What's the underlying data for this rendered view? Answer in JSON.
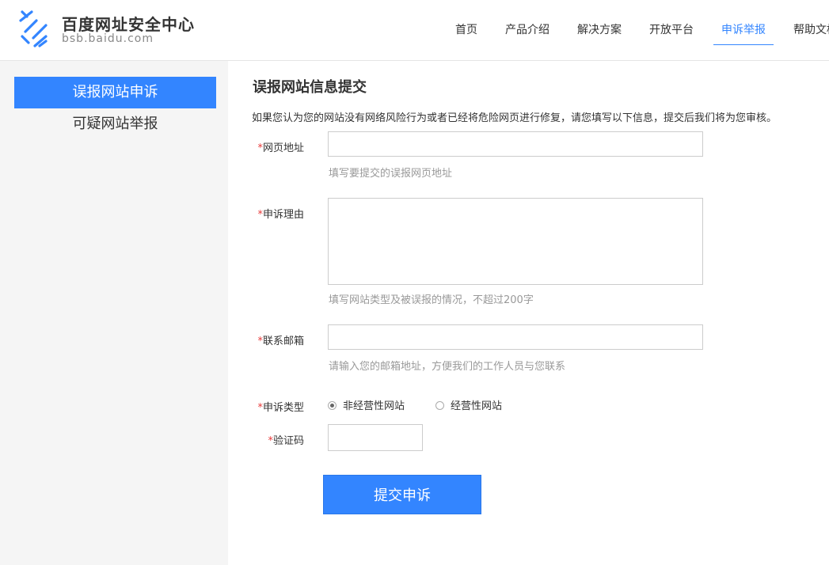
{
  "header": {
    "logo_title": "百度网址安全中心",
    "logo_subtitle": "bsb.baidu.com",
    "nav": [
      {
        "label": "首页"
      },
      {
        "label": "产品介绍"
      },
      {
        "label": "解决方案"
      },
      {
        "label": "开放平台"
      },
      {
        "label": "申诉举报",
        "active": true
      },
      {
        "label": "帮助文档"
      }
    ]
  },
  "sidebar": {
    "items": [
      {
        "label": "误报网站申诉",
        "active": true
      },
      {
        "label": "可疑网站举报"
      }
    ]
  },
  "form": {
    "title": "误报网站信息提交",
    "intro": "如果您认为您的网站没有网络风险行为或者已经将危险网页进行修复，请您填写以下信息，提交后我们将为您审核。",
    "required_mark": "*",
    "url": {
      "label": "网页地址",
      "value": "",
      "hint": "填写要提交的误报网页地址"
    },
    "reason": {
      "label": "申诉理由",
      "value": "",
      "hint": "填写网站类型及被误报的情况，不超过200字"
    },
    "email": {
      "label": "联系邮箱",
      "value": "",
      "hint": "请输入您的邮箱地址，方便我们的工作人员与您联系"
    },
    "type": {
      "label": "申诉类型",
      "options": [
        {
          "label": "非经营性网站",
          "checked": true
        },
        {
          "label": "经营性网站",
          "checked": false
        }
      ]
    },
    "captcha": {
      "label": "验证码",
      "value": ""
    },
    "submit_label": "提交申诉"
  },
  "colors": {
    "accent": "#3385ff",
    "required": "#e83a3a",
    "hint": "#999999"
  }
}
